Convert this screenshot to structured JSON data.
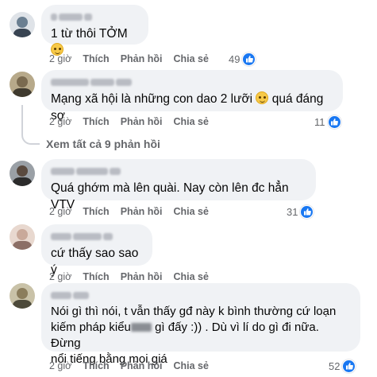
{
  "comments": [
    {
      "text": "1 từ thôi TỞM",
      "time": "2 giờ",
      "like_label": "Thích",
      "reply_label": "Phản hồi",
      "share_label": "Chia sẻ",
      "reactions": "49",
      "avatar_color": "#6b7f91"
    },
    {
      "text_before": "Mạng xã hội là những con dao 2 lưỡi ",
      "text_after": " quá đáng sợ",
      "time": "2 giờ",
      "like_label": "Thích",
      "reply_label": "Phản hồi",
      "share_label": "Chia sẻ",
      "reactions": "11",
      "avatar_color": "#7a6a4f"
    },
    {
      "text": "Quá ghớm mà lên quài. Nay còn lên đc hẳn VTV",
      "time": "2 giờ",
      "like_label": "Thích",
      "reply_label": "Phản hồi",
      "share_label": "Chia sẻ",
      "reactions": "31",
      "avatar_color": "#4a4a4a"
    },
    {
      "text": "cứ thấy sao sao ý",
      "time": "2 giờ",
      "like_label": "Thích",
      "reply_label": "Phản hồi",
      "share_label": "Chia sẻ",
      "avatar_color": "#c9a99a"
    },
    {
      "line1": "Nói gì thì nói, t vẫn thấy gđ này k bình thường cứ loạn",
      "line2_before": "kiếm pháp kiểu",
      "line2_after": "gì đấy :)) . Dù vì lí do gì đi nữa. Đừng",
      "line3": "nổi tiếng bằng mọi giá",
      "time": "2 giờ",
      "like_label": "Thích",
      "reply_label": "Phản hồi",
      "share_label": "Chia sẻ",
      "reactions": "52",
      "avatar_color": "#8b7d5c"
    }
  ],
  "see_all_replies": "Xem tất cả 9 phản hồi",
  "like_color": "#1877f2"
}
